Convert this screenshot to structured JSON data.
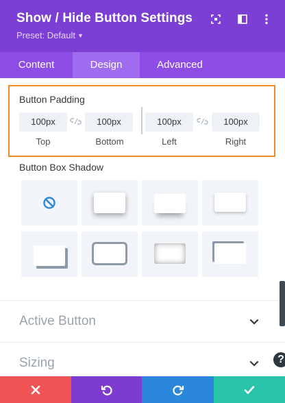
{
  "header": {
    "title": "Show / Hide Button Settings",
    "preset": "Preset: Default",
    "icons": [
      "focus-icon",
      "split-layout-icon",
      "more-options-icon"
    ]
  },
  "tabs": [
    {
      "label": "Content",
      "active": false
    },
    {
      "label": "Design",
      "active": true
    },
    {
      "label": "Advanced",
      "active": false
    }
  ],
  "button_padding": {
    "label": "Button Padding",
    "fields": [
      {
        "value": "100px",
        "label": "Top"
      },
      {
        "value": "100px",
        "label": "Bottom"
      },
      {
        "value": "100px",
        "label": "Left"
      },
      {
        "value": "100px",
        "label": "Right"
      }
    ],
    "link_icons": [
      "link-icon",
      "link-icon"
    ]
  },
  "button_box_shadow": {
    "label": "Button Box Shadow",
    "options": [
      "none",
      "bottom-right",
      "bottom",
      "subtle",
      "offset-left",
      "border-heavy",
      "inset",
      "corner-outline"
    ],
    "selected": "none"
  },
  "toggles": [
    {
      "label": "Active Button",
      "icon": "chevron-down-icon"
    },
    {
      "label": "Sizing",
      "icon": "chevron-down-icon"
    }
  ],
  "footer": {
    "buttons": [
      {
        "name": "cancel",
        "icon": "close-icon",
        "color": "#ef5555"
      },
      {
        "name": "undo",
        "icon": "undo-icon",
        "color": "#7e3bd0"
      },
      {
        "name": "redo",
        "icon": "redo-icon",
        "color": "#2b87da"
      },
      {
        "name": "save",
        "icon": "check-icon",
        "color": "#29c4a9"
      }
    ]
  },
  "colors": {
    "header": "#7b3fd3",
    "tabs": "#8c4ce5",
    "active_tab": "#9f6cef",
    "highlight_border": "#f08a24",
    "selected_shadow_icon": "#2b87da"
  },
  "help_symbol": "?"
}
